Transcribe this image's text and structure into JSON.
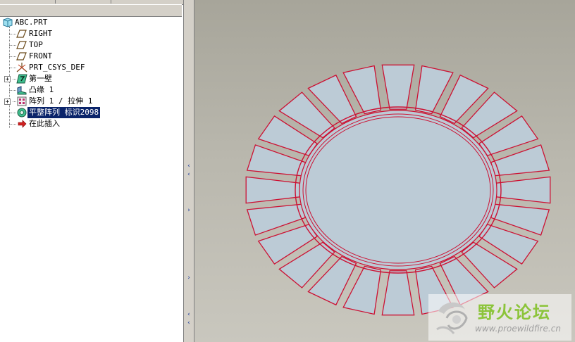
{
  "model_tree": {
    "items": [
      {
        "id": "root",
        "label": "ABC.PRT",
        "icon": "part-icon"
      },
      {
        "id": "right",
        "label": "RIGHT",
        "icon": "datum-plane-icon"
      },
      {
        "id": "top",
        "label": "TOP",
        "icon": "datum-plane-icon"
      },
      {
        "id": "front",
        "label": "FRONT",
        "icon": "datum-plane-icon"
      },
      {
        "id": "csys",
        "label": "PRT_CSYS_DEF",
        "icon": "coordinate-system-icon"
      },
      {
        "id": "first_wall",
        "label": "第一壁",
        "icon": "sheetmetal-wall-icon"
      },
      {
        "id": "flange",
        "label": "凸缘 1",
        "icon": "flange-icon"
      },
      {
        "id": "pattern",
        "label": "阵列 1 / 拉伸 1",
        "icon": "pattern-icon"
      },
      {
        "id": "flat_pattern",
        "label": "平整阵列 标识2098",
        "icon": "flat-pattern-icon",
        "selected": true
      },
      {
        "id": "insert_here",
        "label": "在此插入",
        "icon": "insert-arrow-icon"
      }
    ]
  },
  "watermark": {
    "title": "野火论坛",
    "url": "www.proewildfire.cn"
  },
  "colors": {
    "selection": "#0a246a",
    "edge_highlight": "#cc1133",
    "part_fill": "#bccbd6",
    "watermark_green": "#8cc43a"
  }
}
